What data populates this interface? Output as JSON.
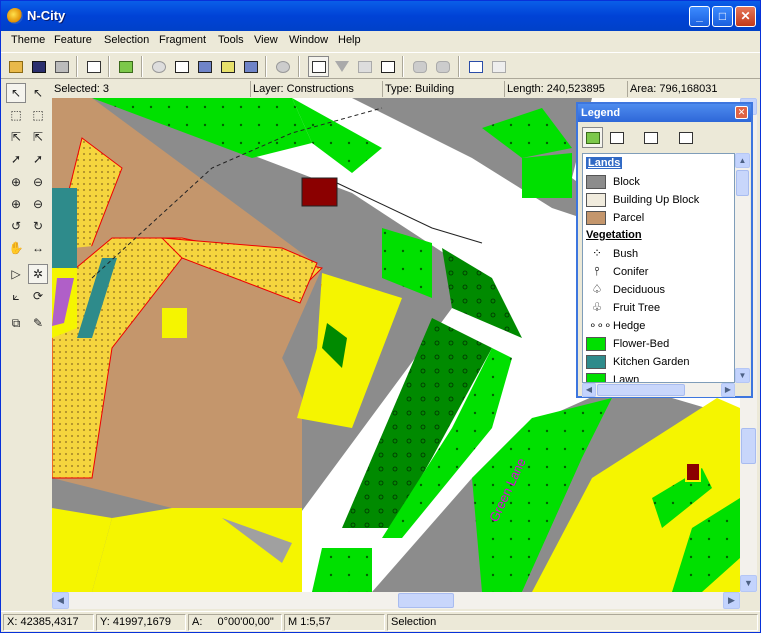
{
  "window": {
    "title": "N-City"
  },
  "menu": [
    "Theme",
    "Feature",
    "Selection",
    "Fragment",
    "Tools",
    "View",
    "Window",
    "Help"
  ],
  "status_top": {
    "selected": "Selected: 3",
    "layer": "Layer: Constructions",
    "type": "Type: Building",
    "length": "Length: 240,523895",
    "area": "Area: 796,168031"
  },
  "legend": {
    "title": "Legend",
    "sections": [
      {
        "header": "Lands",
        "items": [
          {
            "label": "Block",
            "color": "#8C8C8C"
          },
          {
            "label": "Building Up Block",
            "color": "#F0EBDD"
          },
          {
            "label": "Parcel",
            "color": "#C4966C"
          }
        ]
      },
      {
        "header": "Vegetation",
        "items": [
          {
            "label": "Bush",
            "icon": "bush-icon"
          },
          {
            "label": "Conifer",
            "icon": "conifer-icon"
          },
          {
            "label": "Deciduous",
            "icon": "deciduous-icon"
          },
          {
            "label": "Fruit Tree",
            "icon": "fruit-tree-icon"
          },
          {
            "label": "Hedge",
            "icon": "hedge-icon"
          },
          {
            "label": "Flower-Bed",
            "color": "#00E000"
          },
          {
            "label": "Kitchen Garden",
            "color": "#2E8B8B"
          },
          {
            "label": "Lawn",
            "color": "#00E000"
          }
        ]
      }
    ]
  },
  "map": {
    "street_label": "Green Lane"
  },
  "status_bottom": {
    "x": "X: 42385,4317",
    "y": "Y: 41997,1679",
    "angle_label": "A:",
    "angle_value": "0°00'00,00\"",
    "scale": "M 1:5,57",
    "mode": "Selection"
  }
}
